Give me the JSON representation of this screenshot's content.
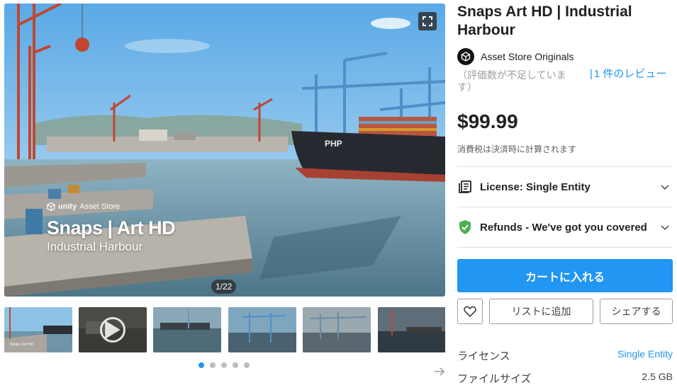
{
  "hero": {
    "brand_logo_text": "unity",
    "brand_store_text": "Asset Store",
    "overlay_title": "Snaps | Art HD",
    "overlay_subtitle": "Industrial Harbour",
    "ship_name": "PHP",
    "counter": "1/22",
    "fullscreen_icon": "fullscreen-icon"
  },
  "gallery": {
    "thumbnail_count": 6,
    "active_thumbnail": 0,
    "dots": 5,
    "active_dot": 0,
    "next_icon": "arrow-right-icon"
  },
  "product": {
    "title": "Snaps Art HD | Industrial Harbour",
    "publisher": "Asset Store Originals",
    "rating_note": "（評価数が不足しています）",
    "review_bar": "|",
    "review_link": "1 件のレビュー",
    "price": "$99.99",
    "tax_note": "消費税は決済時に計算されます"
  },
  "accordions": {
    "license": {
      "label": "License: Single Entity",
      "icon": "license-icon"
    },
    "refunds": {
      "label": "Refunds - We've got you covered",
      "icon": "shield-check-icon"
    }
  },
  "actions": {
    "add_to_cart": "カートに入れる",
    "favorite_icon": "heart-icon",
    "add_to_list": "リストに追加",
    "share": "シェアする"
  },
  "details": [
    {
      "key": "ライセンス",
      "value": "Single Entity",
      "is_link": true
    },
    {
      "key": "ファイルサイズ",
      "value": "2.5 GB",
      "is_link": false
    }
  ],
  "colors": {
    "accent": "#2196f3",
    "refund_check": "#4caf50",
    "text": "#212121",
    "muted": "#9e9e9e"
  }
}
